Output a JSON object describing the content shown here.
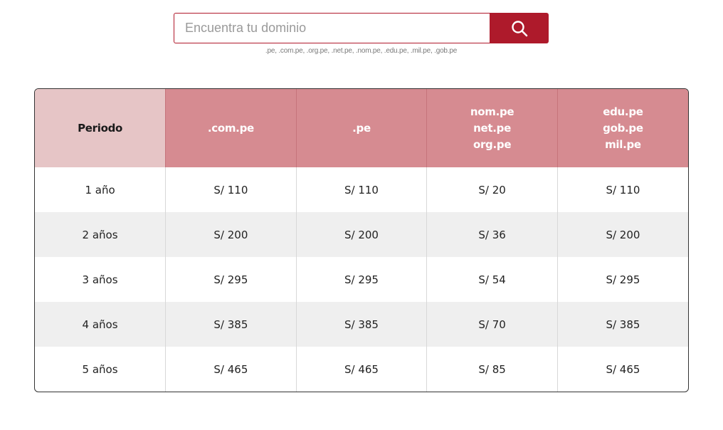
{
  "search": {
    "placeholder": "Encuentra tu dominio",
    "hint": ".pe, .com.pe, .org.pe, .net.pe, .nom.pe, .edu.pe, .mil.pe, .gob.pe"
  },
  "colors": {
    "accent": "#ae1a2b",
    "header_pink": "#d68b91",
    "header_light": "#e6c5c6",
    "row_alt": "#efefef"
  },
  "table": {
    "headers": [
      [
        "Periodo"
      ],
      [
        ".com.pe"
      ],
      [
        ".pe"
      ],
      [
        "nom.pe",
        "net.pe",
        "org.pe"
      ],
      [
        "edu.pe",
        "gob.pe",
        "mil.pe"
      ]
    ],
    "rows": [
      [
        "1 año",
        "S/ 110",
        "S/ 110",
        "S/ 20",
        "S/ 110"
      ],
      [
        "2 años",
        "S/ 200",
        "S/ 200",
        "S/ 36",
        "S/ 200"
      ],
      [
        "3 años",
        "S/ 295",
        "S/ 295",
        "S/ 54",
        "S/ 295"
      ],
      [
        "4 años",
        "S/ 385",
        "S/ 385",
        "S/ 70",
        "S/ 385"
      ],
      [
        "5 años",
        "S/ 465",
        "S/ 465",
        "S/ 85",
        "S/ 465"
      ]
    ]
  }
}
